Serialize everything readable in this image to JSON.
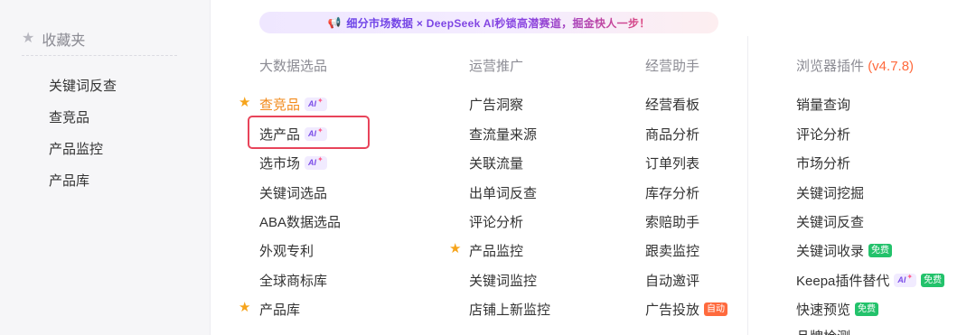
{
  "sidebar": {
    "title": "收藏夹",
    "items": [
      "关键词反查",
      "查竞品",
      "产品监控",
      "产品库"
    ]
  },
  "banner": {
    "text": "细分市场数据 × DeepSeek AI秒锁高潜赛道，掘金快人一步！"
  },
  "columns": {
    "big_data": {
      "title": "大数据选品",
      "items": [
        "查竞品",
        "选产品",
        "选市场",
        "关键词选品",
        "ABA数据选品",
        "外观专利",
        "全球商标库",
        "产品库"
      ]
    },
    "operations": {
      "title": "运营推广",
      "items": [
        "广告洞察",
        "查流量来源",
        "关联流量",
        "出单词反查",
        "评论分析",
        "产品监控",
        "关键词监控",
        "店铺上新监控"
      ]
    },
    "assistant": {
      "title": "经营助手",
      "items": [
        "经营看板",
        "商品分析",
        "订单列表",
        "库存分析",
        "索赔助手",
        "跟卖监控",
        "自动邀评",
        "广告投放"
      ]
    },
    "plugin": {
      "title": "浏览器插件",
      "version": "(v4.7.8)",
      "items": [
        "销量查询",
        "评论分析",
        "市场分析",
        "关键词挖掘",
        "关键词反查",
        "关键词收录",
        "Keepa插件替代",
        "快速预览",
        "品牌检测"
      ]
    }
  },
  "badges": {
    "ai": "AI",
    "free": "免费",
    "auto": "自动"
  },
  "colors": {
    "accent_orange": "#f28a1b",
    "star": "#f6a41b",
    "highlight": "#e8445a",
    "free_green": "#23c26b"
  }
}
